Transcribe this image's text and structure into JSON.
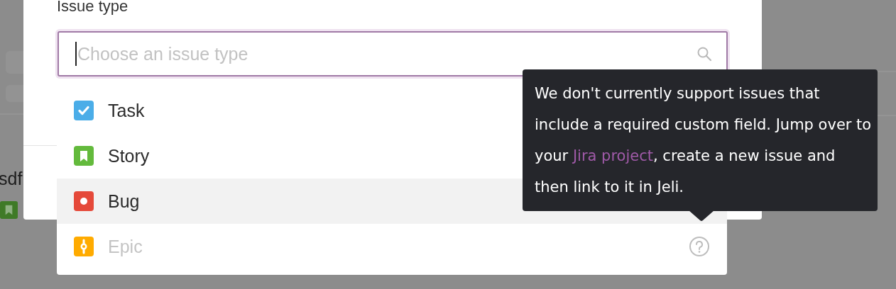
{
  "background": {
    "row_title": "sdf"
  },
  "modal": {
    "field_label": "Issue type",
    "search": {
      "placeholder": "Choose an issue type"
    }
  },
  "dropdown": {
    "options": [
      {
        "label": "Task",
        "kind": "task",
        "selected": false,
        "disabled": false
      },
      {
        "label": "Story",
        "kind": "story",
        "selected": false,
        "disabled": false
      },
      {
        "label": "Bug",
        "kind": "bug",
        "selected": true,
        "disabled": false
      },
      {
        "label": "Epic",
        "kind": "epic",
        "selected": false,
        "disabled": true
      }
    ]
  },
  "tooltip": {
    "text_before": "We don't currently support issues that include a required custom field. Jump over to your ",
    "link": "Jira project",
    "text_after": ", create a new issue and then link to it in Jeli."
  }
}
